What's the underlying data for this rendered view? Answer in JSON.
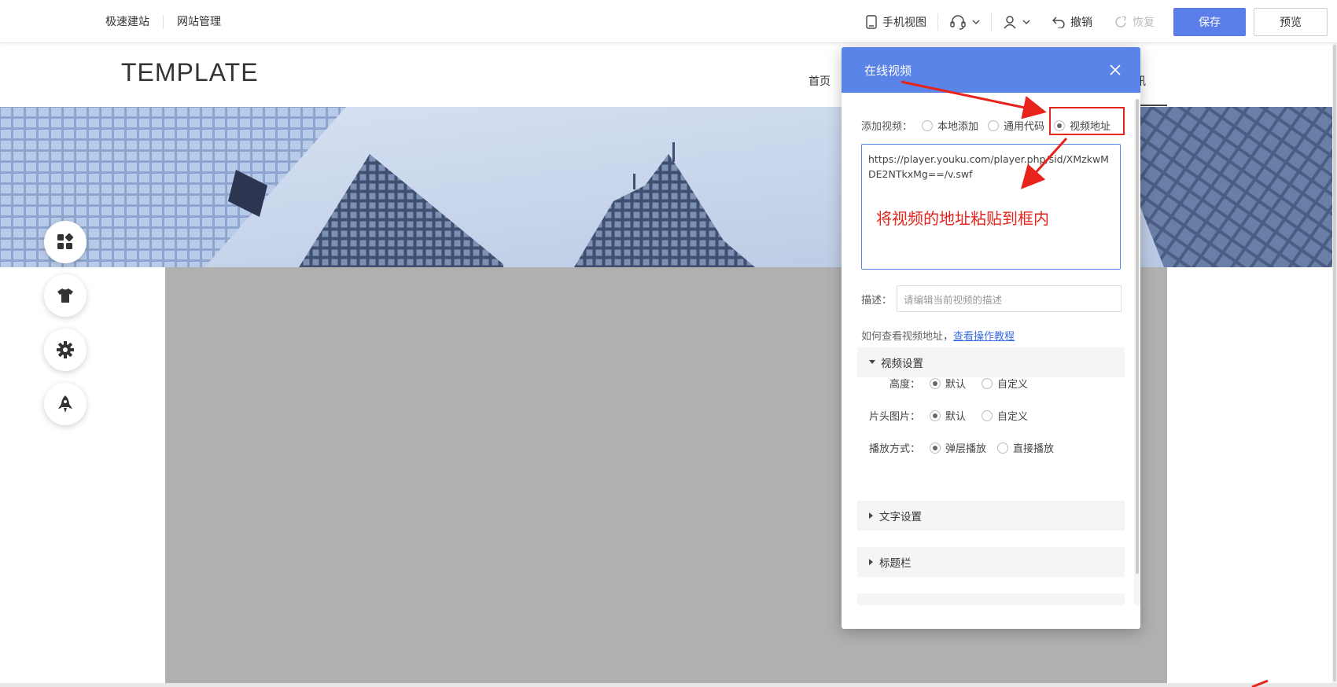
{
  "toolbar": {
    "left_links": [
      "极速建站",
      "网站管理"
    ],
    "mobile_view": "手机视图",
    "undo": "撤销",
    "redo": "恢复",
    "save": "保存",
    "preview": "预览"
  },
  "site": {
    "logo": "TEMPLATE",
    "nav_home": "首页",
    "nav_partial": "讯"
  },
  "dialog": {
    "title": "在线视频",
    "add_label": "添加视频：",
    "add_options": [
      "本地添加",
      "通用代码",
      "视频地址"
    ],
    "selected_option": "视频地址",
    "url_value": "https://player.youku.com/player.php/sid/XMzkwMDE2NTkxMg==/v.swf",
    "desc_label": "描述：",
    "desc_placeholder": "请编辑当前视频的描述",
    "howto_text": "如何查看视频地址，",
    "howto_link": "查看操作教程",
    "sections": {
      "video_settings": "视频设置",
      "text_settings": "文字设置",
      "title_bar": "标题栏"
    },
    "options": {
      "height_label": "高度：",
      "cover_label": "片头图片：",
      "play_label": "播放方式：",
      "default": "默认",
      "custom": "自定义",
      "popup_play": "弹层播放",
      "direct_play": "直接播放"
    }
  },
  "annotation": {
    "text": "将视频的地址粘贴到框内",
    "color": "#e8231b"
  },
  "colors": {
    "primary": "#5a7de8",
    "dialog_header": "#5b84e8"
  }
}
